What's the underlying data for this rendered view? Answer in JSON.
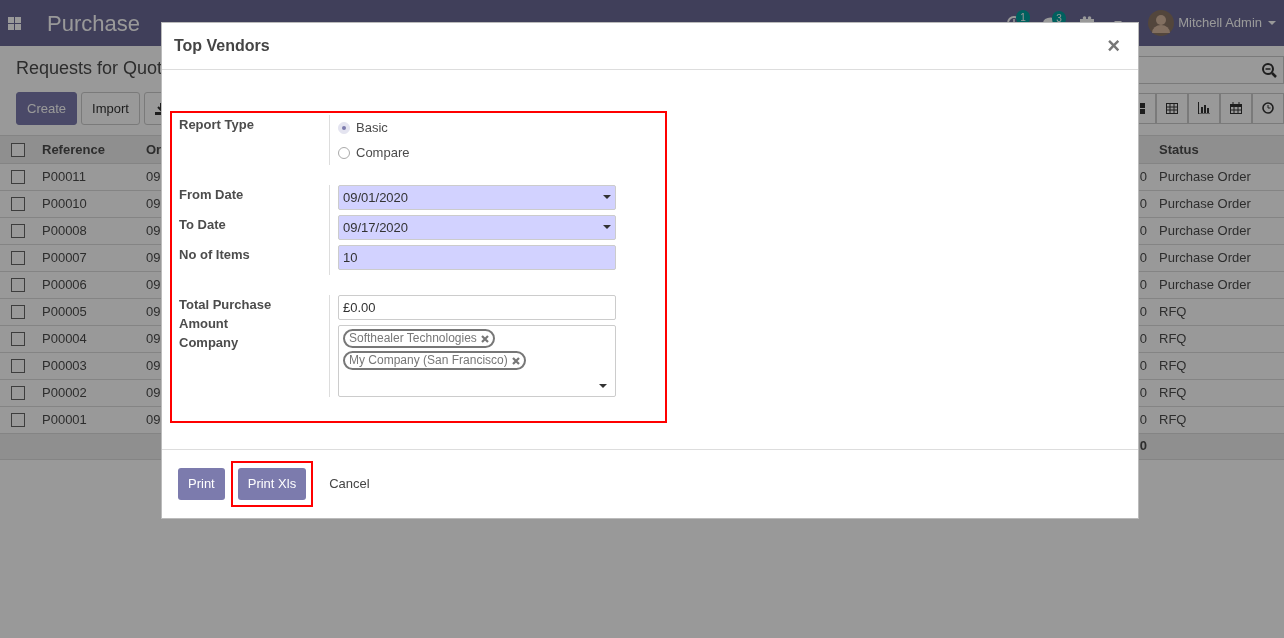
{
  "navbar": {
    "app_name": "Purchase",
    "activity_count": "1",
    "message_count": "3",
    "user": "Mitchell Admin"
  },
  "control_panel": {
    "title": "Requests for Quot",
    "buttons": [
      {
        "label": "Create",
        "kind": "primary"
      },
      {
        "label": "Import",
        "kind": "secondary"
      }
    ]
  },
  "table": {
    "all_checked": false,
    "columns": [
      "Reference",
      "Or",
      "Status"
    ],
    "rows": [
      {
        "checked": false,
        "reference": "P00011",
        "order_date": "09",
        "amount": "0",
        "status": "Purchase Order"
      },
      {
        "checked": false,
        "reference": "P00010",
        "order_date": "09",
        "amount": "0",
        "status": "Purchase Order"
      },
      {
        "checked": false,
        "reference": "P00008",
        "order_date": "09",
        "amount": "0",
        "status": "Purchase Order"
      },
      {
        "checked": false,
        "reference": "P00007",
        "order_date": "09",
        "amount": "0",
        "status": "Purchase Order"
      },
      {
        "checked": false,
        "reference": "P00006",
        "order_date": "09",
        "amount": "0",
        "status": "Purchase Order"
      },
      {
        "checked": false,
        "reference": "P00005",
        "order_date": "09",
        "amount": "0",
        "status": "RFQ"
      },
      {
        "checked": false,
        "reference": "P00004",
        "order_date": "09",
        "amount": "0",
        "status": "RFQ"
      },
      {
        "checked": false,
        "reference": "P00003",
        "order_date": "09",
        "amount": "0",
        "status": "RFQ"
      },
      {
        "checked": false,
        "reference": "P00002",
        "order_date": "09",
        "amount": "0",
        "status": "RFQ"
      },
      {
        "checked": false,
        "reference": "P00001",
        "order_date": "09",
        "amount": "0",
        "status": "RFQ"
      }
    ],
    "total": "0"
  },
  "dialog": {
    "title": "Top Vendors",
    "close_label": "×",
    "form_highlighted": true,
    "groups": [
      {
        "fields": [
          {
            "label": "Report Type",
            "kind": "radio",
            "options": [
              {
                "label": "Basic",
                "selected": true
              },
              {
                "label": "Compare",
                "selected": false
              }
            ]
          }
        ]
      },
      {
        "fields": [
          {
            "label": "From Date",
            "kind": "date",
            "value": "09/01/2020",
            "required": true
          },
          {
            "label": "To Date",
            "kind": "date",
            "value": "09/17/2020",
            "required": true
          },
          {
            "label": "No of Items",
            "kind": "text",
            "value": "10",
            "required": true
          }
        ]
      },
      {
        "fields": [
          {
            "label": "Total Purchase Amount",
            "kind": "text",
            "value": "£0.00",
            "required": false
          },
          {
            "label": "Company",
            "kind": "tags",
            "tags": [
              "Softhealer Technologies",
              "My Company (San Francisco)"
            ]
          }
        ]
      }
    ],
    "buttons": [
      {
        "label": "Print",
        "kind": "primary",
        "highlighted": false
      },
      {
        "label": "Print Xls",
        "kind": "primary",
        "highlighted": true
      },
      {
        "label": "Cancel",
        "kind": "link",
        "highlighted": false
      }
    ]
  }
}
